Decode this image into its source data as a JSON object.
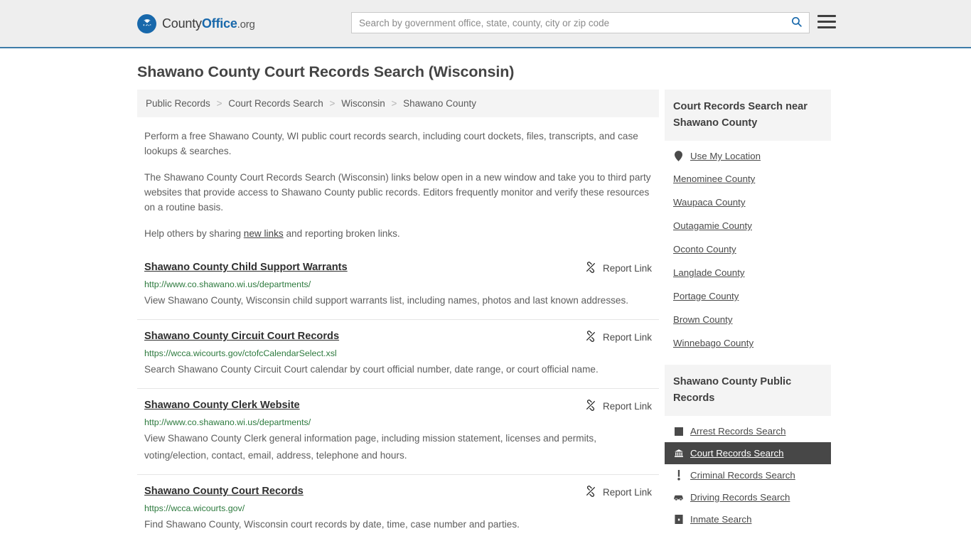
{
  "header": {
    "brand": {
      "part1": "County",
      "part2": "Office",
      "tld": ".org"
    },
    "brand_icon": "eagle-seal-icon",
    "search": {
      "placeholder": "Search by government office, state, county, city or zip code",
      "value": "",
      "icon": "search-icon"
    },
    "menu_icon": "hamburger-menu-icon",
    "accent_color": "#3d7ca8"
  },
  "page_title": "Shawano County Court Records Search (Wisconsin)",
  "breadcrumb": {
    "separator": ">",
    "items": [
      {
        "label": "Public Records"
      },
      {
        "label": "Court Records Search"
      },
      {
        "label": "Wisconsin"
      },
      {
        "label": "Shawano County"
      }
    ]
  },
  "intro": {
    "p1": "Perform a free Shawano County, WI public court records search, including court dockets, files, transcripts, and case lookups & searches.",
    "p2": "The Shawano County Court Records Search (Wisconsin) links below open in a new window and take you to third party websites that provide access to Shawano County public records. Editors frequently monitor and verify these resources on a routine basis.",
    "p3_before": "Help others by sharing ",
    "p3_link": "new links",
    "p3_after": " and reporting broken links."
  },
  "report_link_label": "Report Link",
  "report_link_icon": "broken-link-icon",
  "results": [
    {
      "title": "Shawano County Child Support Warrants",
      "url": "http://www.co.shawano.wi.us/departments/",
      "description": "View Shawano County, Wisconsin child support warrants list, including names, photos and last known addresses."
    },
    {
      "title": "Shawano County Circuit Court Records",
      "url": "https://wcca.wicourts.gov/ctofcCalendarSelect.xsl",
      "description": "Search Shawano County Circuit Court calendar by court official number, date range, or court official name."
    },
    {
      "title": "Shawano County Clerk Website",
      "url": "http://www.co.shawano.wi.us/departments/",
      "description": "View Shawano County Clerk general information page, including mission statement, licenses and permits, voting/election, contact, email, address, telephone and hours."
    },
    {
      "title": "Shawano County Court Records",
      "url": "https://wcca.wicourts.gov/",
      "description": "Find Shawano County, Wisconsin court records by date, time, case number and parties."
    }
  ],
  "sidebar": {
    "nearby": {
      "heading": "Court Records Search near Shawano County",
      "use_my_location": {
        "label": "Use My Location",
        "icon": "map-pin-icon"
      },
      "counties": [
        {
          "label": "Menominee County"
        },
        {
          "label": "Waupaca County"
        },
        {
          "label": "Outagamie County"
        },
        {
          "label": "Oconto County"
        },
        {
          "label": "Langlade County"
        },
        {
          "label": "Portage County"
        },
        {
          "label": "Brown County"
        },
        {
          "label": "Winnebago County"
        }
      ]
    },
    "public_records": {
      "heading": "Shawano County Public Records",
      "items": [
        {
          "label": "Arrest Records Search",
          "icon": "square-badge-icon",
          "active": false
        },
        {
          "label": "Court Records Search",
          "icon": "courthouse-icon",
          "active": true
        },
        {
          "label": "Criminal Records Search",
          "icon": "exclamation-icon",
          "active": false
        },
        {
          "label": "Driving Records Search",
          "icon": "car-icon",
          "active": false
        },
        {
          "label": "Inmate Search",
          "icon": "jail-door-icon",
          "active": false
        }
      ],
      "active_bg": "#474747"
    }
  }
}
